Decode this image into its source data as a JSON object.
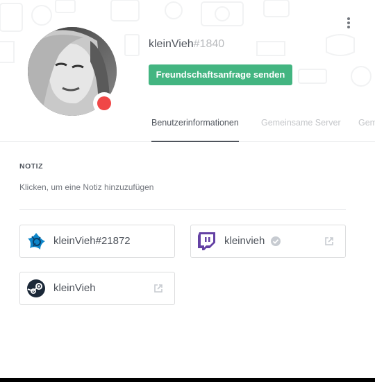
{
  "profile": {
    "username": "kleinVieh",
    "discriminator": "#1840",
    "status": "do-not-disturb",
    "status_color": "#f04747",
    "friend_button_label": "Freundschaftsanfrage senden",
    "friend_button_color": "#43b581"
  },
  "tabs": [
    {
      "label": "Benutzerinformationen",
      "active": true
    },
    {
      "label": "Gemeinsame Server",
      "active": false
    },
    {
      "label": "Gem",
      "active": false
    }
  ],
  "note": {
    "title": "NOTIZ",
    "placeholder": "Klicken, um eine Notiz hinzuzufügen"
  },
  "connected_accounts": [
    {
      "service": "battlenet",
      "icon": "battlenet-icon",
      "name": "kleinVieh#21872",
      "verified": false,
      "external_link": false
    },
    {
      "service": "twitch",
      "icon": "twitch-icon",
      "name": "kleinvieh",
      "verified": true,
      "external_link": true
    },
    {
      "service": "steam",
      "icon": "steam-icon",
      "name": "kleinVieh",
      "verified": false,
      "external_link": true
    }
  ]
}
